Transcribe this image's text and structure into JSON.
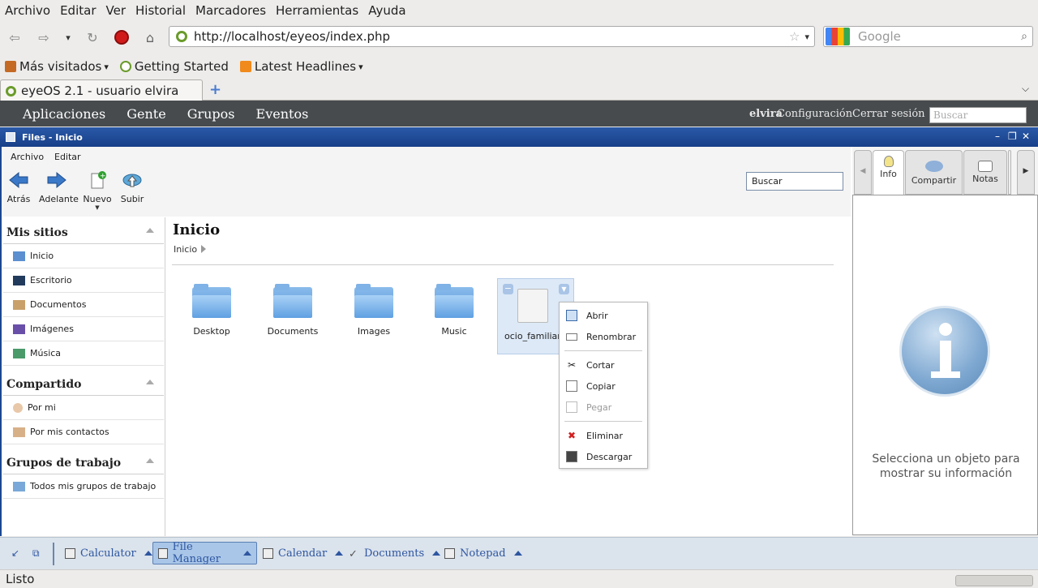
{
  "firefox": {
    "menu": [
      "Archivo",
      "Editar",
      "Ver",
      "Historial",
      "Marcadores",
      "Herramientas",
      "Ayuda"
    ],
    "url": "http://localhost/eyeos/index.php",
    "search_placeholder": "Google",
    "bookmarks": [
      "Más visitados",
      "Getting Started",
      "Latest Headlines"
    ],
    "tab_title": "eyeOS 2.1 - usuario elvira",
    "status": "Listo"
  },
  "eyeos": {
    "menu": [
      "Aplicaciones",
      "Gente",
      "Grupos",
      "Eventos"
    ],
    "user": "elvira",
    "config": "Configuración",
    "logout": "Cerrar sesión",
    "search_placeholder": "Buscar"
  },
  "window": {
    "title": "Files - Inicio",
    "menu": [
      "Archivo",
      "Editar"
    ],
    "toolbar": [
      "Atrás",
      "Adelante",
      "Nuevo",
      "Subir"
    ],
    "search": "Buscar"
  },
  "sidebar": {
    "mis_sitios": "Mis sitios",
    "sitios": [
      "Inicio",
      "Escritorio",
      "Documentos",
      "Imágenes",
      "Música"
    ],
    "compartido": "Compartido",
    "compartido_items": [
      "Por mi",
      "Por mis contactos"
    ],
    "grupos": "Grupos de trabajo",
    "grupos_items": [
      "Todos mis grupos de trabajo"
    ]
  },
  "main": {
    "title": "Inicio",
    "breadcrumb": "Inicio",
    "files": [
      "Desktop",
      "Documents",
      "Images",
      "Music",
      "ocio_familiar.o"
    ]
  },
  "context_menu": [
    "Abrir",
    "Renombrar",
    "Cortar",
    "Copiar",
    "Pegar",
    "Eliminar",
    "Descargar"
  ],
  "right_panel": {
    "tabs": [
      "Info",
      "Compartir",
      "Notas"
    ],
    "info_text": "Selecciona un objeto para mostrar su información"
  },
  "taskbar": [
    "Calculator",
    "File Manager",
    "Calendar",
    "Documents",
    "Notepad"
  ],
  "colors": {
    "accent": "#1d4690",
    "eyebar": "#474b4e",
    "taskbar_text": "#2e56a1"
  }
}
